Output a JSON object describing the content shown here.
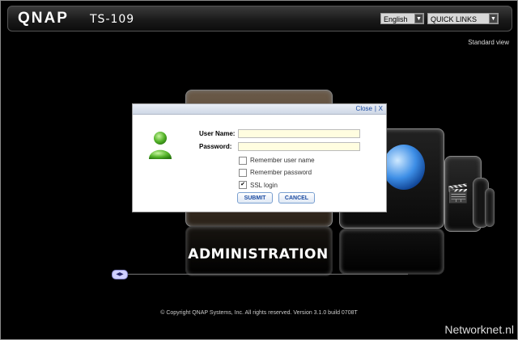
{
  "header": {
    "brand": "QNAP",
    "model": "TS-109",
    "language": "English",
    "quick_links": "QUICK LINKS",
    "standard_view": "Standard view"
  },
  "stage": {
    "active_label": "ADMINISTRATION"
  },
  "dialog": {
    "close_label": "Close",
    "separator": "|",
    "close_x": "X",
    "username_label": "User Name:",
    "password_label": "Password:",
    "username_value": "",
    "password_value": "",
    "remember_user_label": "Remember user name",
    "remember_user_checked": false,
    "remember_pass_label": "Remember password",
    "remember_pass_checked": false,
    "ssl_label": "SSL login",
    "ssl_checked": true,
    "submit_label": "SUBMIT",
    "cancel_label": "CANCEL"
  },
  "slider_handle": "◀▶",
  "footer": {
    "copyright": "© Copyright QNAP Systems, Inc. All rights reserved. Version 3.1.0 build 0708T"
  },
  "watermark": "Networknet.nl",
  "icons": {
    "user": "user-icon",
    "globe": "globe-icon",
    "clapperboard": "clapperboard-icon"
  }
}
